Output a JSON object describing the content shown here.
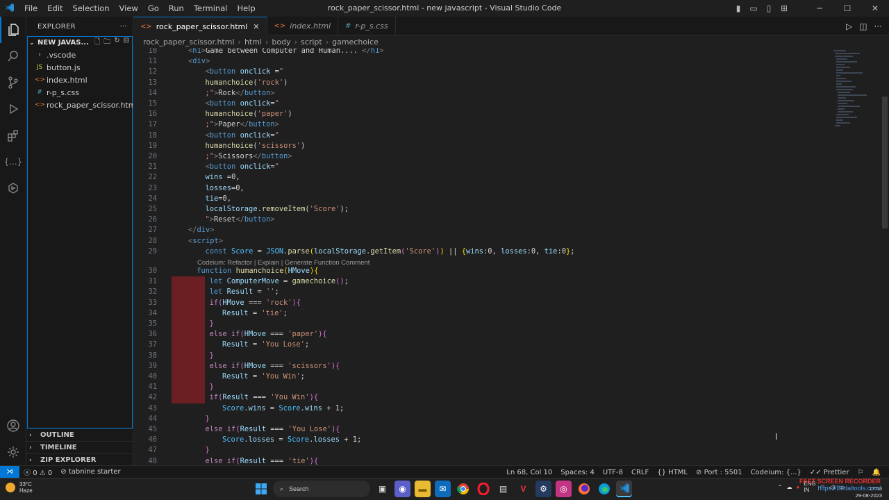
{
  "menu": [
    "File",
    "Edit",
    "Selection",
    "View",
    "Go",
    "Run",
    "Terminal",
    "Help"
  ],
  "window_title": "rock_paper_scissor.html - new javascript - Visual Studio Code",
  "sidebar": {
    "header": "EXPLORER",
    "folder": "NEW JAVAS...",
    "items": [
      {
        "label": ".vscode",
        "icon": "folder-chevron-icon",
        "kind": "folder"
      },
      {
        "label": "button.js",
        "icon": "js-file-icon",
        "kind": "js"
      },
      {
        "label": "index.html",
        "icon": "html-file-icon",
        "kind": "html"
      },
      {
        "label": "r-p_s.css",
        "icon": "css-file-icon",
        "kind": "css"
      },
      {
        "label": "rock_paper_scissor.html",
        "icon": "html-file-icon",
        "kind": "html"
      }
    ],
    "sections": [
      "OUTLINE",
      "TIMELINE",
      "ZIP EXPLORER"
    ]
  },
  "tabs": [
    {
      "label": "rock_paper_scissor.html",
      "active": true
    },
    {
      "label": "index.html",
      "active": false
    },
    {
      "label": "r-p_s.css",
      "active": false
    }
  ],
  "breadcrumb": [
    "rock_paper_scissor.html",
    "html",
    "body",
    "script",
    "gamechoice"
  ],
  "codelens": "Codeium: Refactor | Explain | Generate Function Comment",
  "code_lines": [
    {
      "n": "10",
      "html": "<span class='t'>&lt;</span><span class='n'>h1</span><span class='t'>&gt;</span><span class='w'>Game between Computer and Human.... </span><span class='t'>&lt;/</span><span class='n'>h1</span><span class='t'>&gt;</span>",
      "indent": 0
    },
    {
      "n": "11",
      "html": "<span class='t'>&lt;</span><span class='n'>div</span><span class='t'>&gt;</span>",
      "indent": 0
    },
    {
      "n": "12",
      "html": "<span class='t'>&lt;</span><span class='n'>button</span> <span class='a'>onclick</span> <span class='w'>=</span><span class='s'>\"</span>",
      "indent": 1
    },
    {
      "n": "13",
      "html": "<span class='f'>humanchoice</span><span class='w'>(</span><span class='s'>'rock'</span><span class='w'>)</span>",
      "indent": 1
    },
    {
      "n": "14",
      "html": "<span class='s'>;\"</span><span class='t'>&gt;</span><span class='w'>Rock</span><span class='t'>&lt;/</span><span class='n'>button</span><span class='t'>&gt;</span>",
      "indent": 1
    },
    {
      "n": "15",
      "html": "<span class='t'>&lt;</span><span class='n'>button</span> <span class='a'>onclick</span><span class='w'>=</span><span class='s'>\"</span>",
      "indent": 1
    },
    {
      "n": "16",
      "html": "<span class='f'>humanchoice</span><span class='w'>(</span><span class='s'>'paper'</span><span class='w'>)</span>",
      "indent": 1
    },
    {
      "n": "17",
      "html": "<span class='s'>;\"</span><span class='t'>&gt;</span><span class='w'>Paper</span><span class='t'>&lt;/</span><span class='n'>button</span><span class='t'>&gt;</span>",
      "indent": 1
    },
    {
      "n": "18",
      "html": "<span class='t'>&lt;</span><span class='n'>button</span> <span class='a'>onclick</span><span class='w'>=</span><span class='s'>\"</span>",
      "indent": 1
    },
    {
      "n": "19",
      "html": "<span class='f'>humanchoice</span><span class='w'>(</span><span class='s'>'scissors'</span><span class='w'>)</span>",
      "indent": 1
    },
    {
      "n": "20",
      "html": "<span class='s'>;\"</span><span class='t'>&gt;</span><span class='w'>Scissors</span><span class='t'>&lt;/</span><span class='n'>button</span><span class='t'>&gt;</span>",
      "indent": 1
    },
    {
      "n": "21",
      "html": "<span class='t'>&lt;</span><span class='n'>button</span> <span class='a'>onclick</span><span class='w'>=</span><span class='s'>\"</span>",
      "indent": 1
    },
    {
      "n": "22",
      "html": "<span class='a'>wins</span> <span class='w'>=</span><span class='w'>0,</span>",
      "indent": 1
    },
    {
      "n": "23",
      "html": "<span class='a'>losses</span><span class='w'>=0,</span>",
      "indent": 1
    },
    {
      "n": "24",
      "html": "<span class='a'>tie</span><span class='w'>=0,</span>",
      "indent": 1
    },
    {
      "n": "25",
      "html": "<span class='a'>localStorage</span><span class='w'>.</span><span class='f'>removeItem</span><span class='w'>(</span><span class='s'>'Score'</span><span class='w'>);</span>",
      "indent": 1
    },
    {
      "n": "26",
      "html": "<span class='s'>\"</span><span class='t'>&gt;</span><span class='w'>Reset</span><span class='t'>&lt;/</span><span class='n'>button</span><span class='t'>&gt;</span>",
      "indent": 1
    },
    {
      "n": "27",
      "html": "<span class='t'>&lt;/</span><span class='n'>div</span><span class='t'>&gt;</span>",
      "indent": 0
    },
    {
      "n": "28",
      "html": "<span class='t'>&lt;</span><span class='n'>script</span><span class='t'>&gt;</span>",
      "indent": 0
    },
    {
      "n": "29",
      "html": "<span class='n'>const</span> <span class='v'>Score</span> <span class='w'>=</span> <span class='v'>JSON</span><span class='w'>.</span><span class='f'>parse</span><span class='y'>(</span><span class='a'>localStorage</span><span class='w'>.</span><span class='f'>getItem</span><span class='p'>(</span><span class='s'>'Score'</span><span class='p'>)</span><span class='y'>)</span> <span class='w'>||</span> <span class='y'>{</span><span class='a'>wins</span><span class='w'>:0, </span><span class='a'>losses</span><span class='w'>:0, </span><span class='a'>tie</span><span class='w'>:0</span><span class='y'>}</span><span class='w'>;</span>",
      "indent": 1
    },
    {
      "n": "30",
      "html": "<span class='n'>function</span> <span class='f'>humanchoice</span><span class='y'>(</span><span class='a'>HMove</span><span class='y'>){</span>",
      "indent": 0.5,
      "lens": true
    },
    {
      "n": "31",
      "html": "<span class='n'>let</span> <span class='a'>ComputerMove</span> <span class='w'>=</span> <span class='f'>gamechoice</span><span class='p'>()</span><span class='w'>;</span>",
      "indent": 1.25,
      "diff": true
    },
    {
      "n": "32",
      "html": "<span class='n'>let</span> <span class='a'>Result</span> <span class='w'>=</span> <span class='s'>''</span><span class='w'>;</span>",
      "indent": 1.25,
      "diff": true
    },
    {
      "n": "33",
      "html": "<span class='k'>if</span><span class='p'>(</span><span class='a'>HMove</span> <span class='w'>===</span> <span class='s'>'rock'</span><span class='p'>){</span>",
      "indent": 1.25,
      "diff": true
    },
    {
      "n": "34",
      "html": "<span class='a'>Result</span> <span class='w'>=</span> <span class='s'>'tie'</span><span class='w'>;</span>",
      "indent": 2,
      "diff": true
    },
    {
      "n": "35",
      "html": "<span class='p'>}</span>",
      "indent": 1.25,
      "diff": true
    },
    {
      "n": "36",
      "html": "<span class='k'>else</span> <span class='k'>if</span><span class='p'>(</span><span class='a'>HMove</span> <span class='w'>===</span> <span class='s'>'paper'</span><span class='p'>){</span>",
      "indent": 1.25,
      "diff": true
    },
    {
      "n": "37",
      "html": "<span class='a'>Result</span> <span class='w'>=</span> <span class='s'>'You Lose'</span><span class='w'>;</span>",
      "indent": 2,
      "diff": true
    },
    {
      "n": "38",
      "html": "<span class='p'>}</span>",
      "indent": 1.25,
      "diff": true
    },
    {
      "n": "39",
      "html": "<span class='k'>else</span> <span class='k'>if</span><span class='p'>(</span><span class='a'>HMove</span> <span class='w'>===</span> <span class='s'>'scissors'</span><span class='p'>){</span>",
      "indent": 1.25,
      "diff": true
    },
    {
      "n": "40",
      "html": "<span class='a'>Result</span> <span class='w'>=</span> <span class='s'>'You Win'</span><span class='w'>;</span>",
      "indent": 2,
      "diff": true
    },
    {
      "n": "41",
      "html": "<span class='p'>}</span>",
      "indent": 1.25,
      "diff": true
    },
    {
      "n": "42",
      "html": "<span class='k'>if</span><span class='p'>(</span><span class='a'>Result</span> <span class='w'>===</span> <span class='s'>'You Win'</span><span class='p'>){</span>",
      "indent": 1.25,
      "diff": true
    },
    {
      "n": "43",
      "html": "<span class='v'>Score</span><span class='w'>.</span><span class='a'>wins</span> <span class='w'>=</span> <span class='v'>Score</span><span class='w'>.</span><span class='a'>wins</span> <span class='w'>+ 1;</span>",
      "indent": 2
    },
    {
      "n": "44",
      "html": "<span class='p'>}</span>",
      "indent": 1
    },
    {
      "n": "45",
      "html": "<span class='k'>else</span> <span class='k'>if</span><span class='p'>(</span><span class='a'>Result</span> <span class='w'>===</span> <span class='s'>'You Lose'</span><span class='p'>){</span>",
      "indent": 1
    },
    {
      "n": "46",
      "html": "<span class='v'>Score</span><span class='w'>.</span><span class='a'>losses</span> <span class='w'>=</span> <span class='v'>Score</span><span class='w'>.</span><span class='a'>losses</span> <span class='w'>+ 1;</span>",
      "indent": 2
    },
    {
      "n": "47",
      "html": "<span class='p'>}</span>",
      "indent": 1
    },
    {
      "n": "48",
      "html": "<span class='k'>else</span> <span class='k'>if</span><span class='p'>(</span><span class='a'>Result</span> <span class='w'>===</span> <span class='s'>'tie'</span><span class='p'>){</span>",
      "indent": 1
    }
  ],
  "status": {
    "errors": "0",
    "warnings": "0",
    "tabnine": "tabnine starter",
    "position": "Ln 68, Col 10",
    "spaces": "Spaces: 4",
    "encoding": "UTF-8",
    "eol": "CRLF",
    "language": "HTML",
    "port": "Port : 5501",
    "codeium": "Codeium: {...}",
    "prettier": "Prettier"
  },
  "taskbar": {
    "temp": "33°C",
    "weather": "Haze",
    "search": "Search",
    "lang": "ENG",
    "region": "IN",
    "time": "17:53",
    "date": "29-08-2023",
    "watermark1": "FAST SCREEN RECORDER",
    "watermark2": "https://Bitdaltools.com/"
  },
  "colors": {
    "accent": "#0078d4",
    "diff_removed": "#6b1f23",
    "html_tag": "#569cd6"
  }
}
